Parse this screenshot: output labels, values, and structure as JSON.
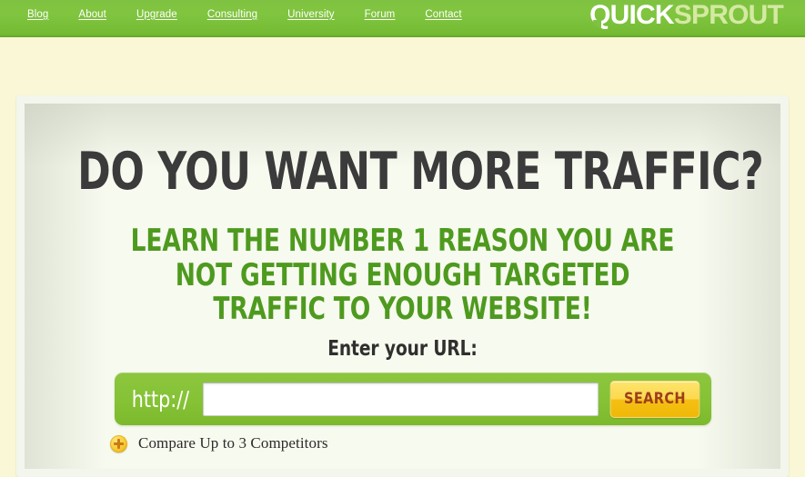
{
  "header": {
    "nav_items": [
      {
        "label": "Blog"
      },
      {
        "label": "About"
      },
      {
        "label": "Upgrade"
      },
      {
        "label": "Consulting"
      },
      {
        "label": "University"
      },
      {
        "label": "Forum"
      },
      {
        "label": "Contact"
      }
    ],
    "logo": {
      "primary": "QUICK",
      "secondary": "SPROUT",
      "primary_color": "#ffffff",
      "secondary_color": "#d4e9a2"
    },
    "background_color": "#7fc242"
  },
  "hero": {
    "headline": "DO YOU WANT MORE TRAFFIC?",
    "headline_color": "#3b3b3b",
    "subheadline_line1": "LEARN THE NUMBER 1 REASON YOU ARE NOT GETTING ENOUGH",
    "subheadline_line2": "TARGETED TRAFFIC TO YOUR WEBSITE!",
    "subheadline_color": "#4e9a1f"
  },
  "form": {
    "label": "Enter your URL:",
    "protocol_prefix": "http://",
    "url_value": "",
    "url_placeholder": "",
    "search_button_label": "SEARCH",
    "search_button_text_color": "#9d3e1b",
    "bar_color": "#8cc63f",
    "compare": {
      "icon": "plus-circle-icon",
      "label": "Compare Up to 3 Competitors"
    }
  },
  "page": {
    "background_color": "#faf7d7",
    "card_background_color": "#f7faee",
    "card_border_color": "#f2f6ec"
  }
}
